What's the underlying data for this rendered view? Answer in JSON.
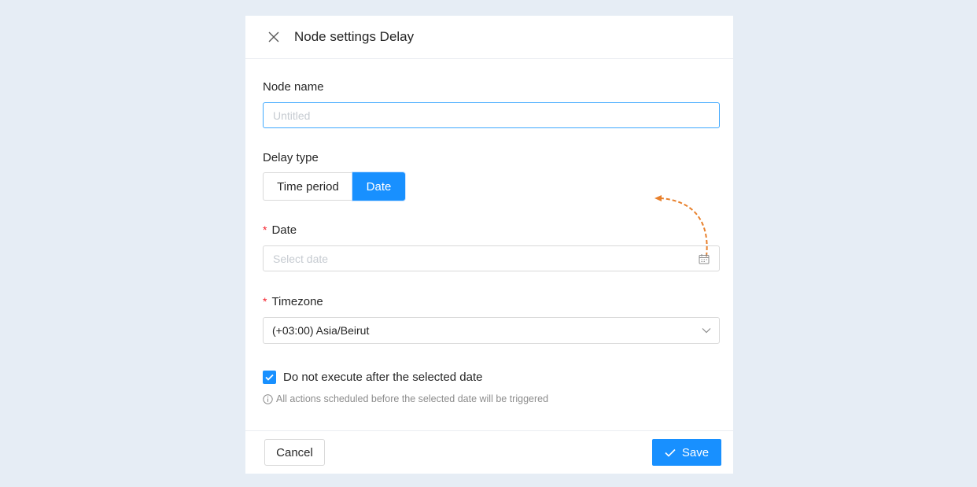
{
  "header": {
    "title": "Node settings Delay",
    "close_icon": "close-icon"
  },
  "node_name": {
    "label": "Node name",
    "value": "",
    "placeholder": "Untitled"
  },
  "delay_type": {
    "label": "Delay type",
    "options": [
      "Time period",
      "Date"
    ],
    "selected": "Date"
  },
  "date": {
    "required_mark": "*",
    "label": "Date",
    "placeholder": "Select date",
    "icon": "calendar-icon"
  },
  "timezone": {
    "required_mark": "*",
    "label": "Timezone",
    "value": "(+03:00) Asia/Beirut",
    "icon": "chevron-down-icon"
  },
  "option": {
    "checked": true,
    "label": "Do not execute after the selected date",
    "hint": "All actions scheduled before the selected date will be triggered",
    "hint_icon": "info-icon"
  },
  "footer": {
    "cancel_label": "Cancel",
    "save_label": "Save"
  },
  "colors": {
    "accent": "#1890ff",
    "required": "#f5222d",
    "annotation_arrow": "#e8802c",
    "background": "#e6edf5"
  }
}
